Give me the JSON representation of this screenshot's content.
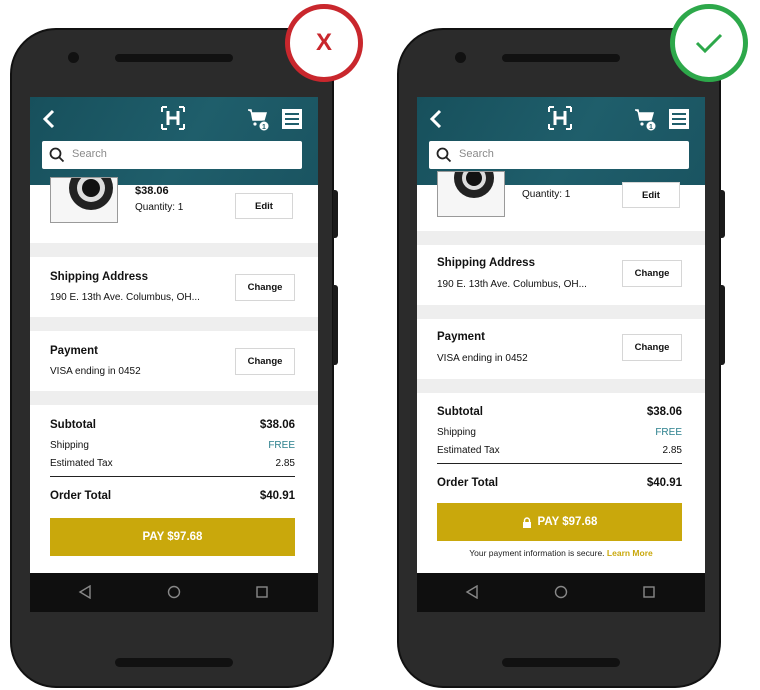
{
  "colors": {
    "appbar": "#1f5e6b",
    "pay_button": "#c9a80c",
    "free_text": "#2a7f8c",
    "bad_badge": "#c9272d",
    "good_badge": "#2da84a"
  },
  "badges": {
    "bad": "X",
    "good_icon": "check-icon"
  },
  "left": {
    "search_placeholder": "Search",
    "cart_count": "1",
    "product": {
      "price": "$38.06",
      "quantity": "Quantity: 1",
      "edit": "Edit"
    },
    "shipping": {
      "title": "Shipping Address",
      "value": "190 E. 13th Ave. Columbus, OH...",
      "change": "Change"
    },
    "payment": {
      "title": "Payment",
      "value": "VISA ending in 0452",
      "change": "Change"
    },
    "summary": {
      "subtotal_label": "Subtotal",
      "subtotal": "$38.06",
      "shipping_label": "Shipping",
      "shipping": "FREE",
      "tax_label": "Estimated Tax",
      "tax": "2.85",
      "total_label": "Order Total",
      "total": "$40.91"
    },
    "pay_label": "PAY $97.68"
  },
  "right": {
    "search_placeholder": "Search",
    "cart_count": "1",
    "product": {
      "quantity": "Quantity: 1",
      "edit": "Edit"
    },
    "shipping": {
      "title": "Shipping Address",
      "value": "190 E. 13th Ave. Columbus, OH...",
      "change": "Change"
    },
    "payment": {
      "title": "Payment",
      "value": "VISA ending in 0452",
      "change": "Change"
    },
    "summary": {
      "subtotal_label": "Subtotal",
      "subtotal": "$38.06",
      "shipping_label": "Shipping",
      "shipping": "FREE",
      "tax_label": "Estimated Tax",
      "tax": "2.85",
      "total_label": "Order Total",
      "total": "$40.91"
    },
    "pay_label": "PAY $97.68",
    "secure_text": "Your payment information is secure.",
    "learn_more": "Learn More"
  }
}
